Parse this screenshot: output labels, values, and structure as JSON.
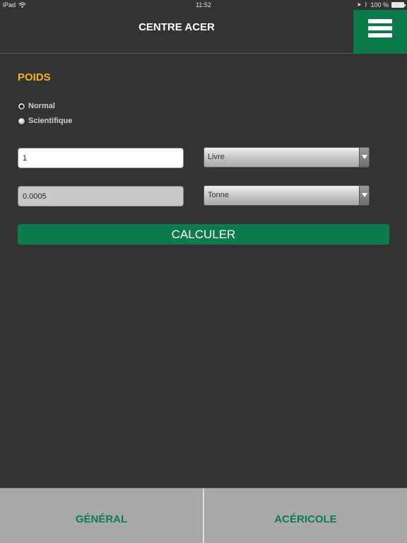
{
  "status_bar": {
    "device": "iPad",
    "time": "11:52",
    "battery": "100 %",
    "icons": [
      "wifi-icon",
      "location-icon",
      "bluetooth-icon",
      "battery-icon"
    ]
  },
  "header": {
    "title": "CENTRE ACER",
    "menu_icon": "hamburger-menu-icon"
  },
  "main": {
    "section_title": "POIDS",
    "radio_options": [
      {
        "label": "Normal",
        "selected": true
      },
      {
        "label": "Scientifique",
        "selected": false
      }
    ],
    "input_value": "1",
    "input_unit": "Livre",
    "output_value": "0.0005",
    "output_unit": "Tonne",
    "calculate_label": "CALCULER"
  },
  "tabs": [
    {
      "label": "GÉNÉRAL"
    },
    {
      "label": "ACÉRICOLE"
    }
  ],
  "colors": {
    "background": "#333333",
    "accent_green": "#0d7a4c",
    "title_yellow": "#f4b223",
    "tab_bar": "#a9a9a9"
  }
}
